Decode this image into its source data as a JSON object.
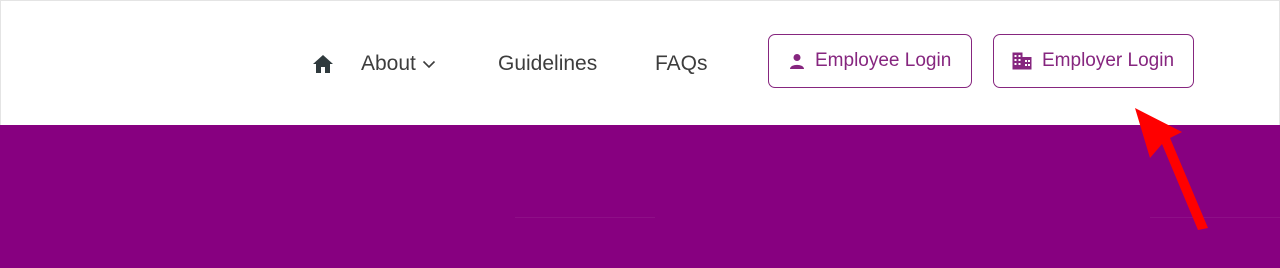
{
  "nav": {
    "home_icon": "home-icon",
    "about_label": "About",
    "about_chevron_icon": "chevron-down-icon",
    "guidelines_label": "Guidelines",
    "faqs_label": "FAQs"
  },
  "actions": {
    "employee_login": {
      "label": "Employee Login",
      "icon": "person-icon"
    },
    "employer_login": {
      "label": "Employer Login",
      "icon": "building-icon"
    }
  },
  "colors": {
    "brand_purple": "#870080",
    "button_accent": "#86267f",
    "nav_text": "#3d3d3d",
    "annotation_arrow": "#ff0000"
  }
}
